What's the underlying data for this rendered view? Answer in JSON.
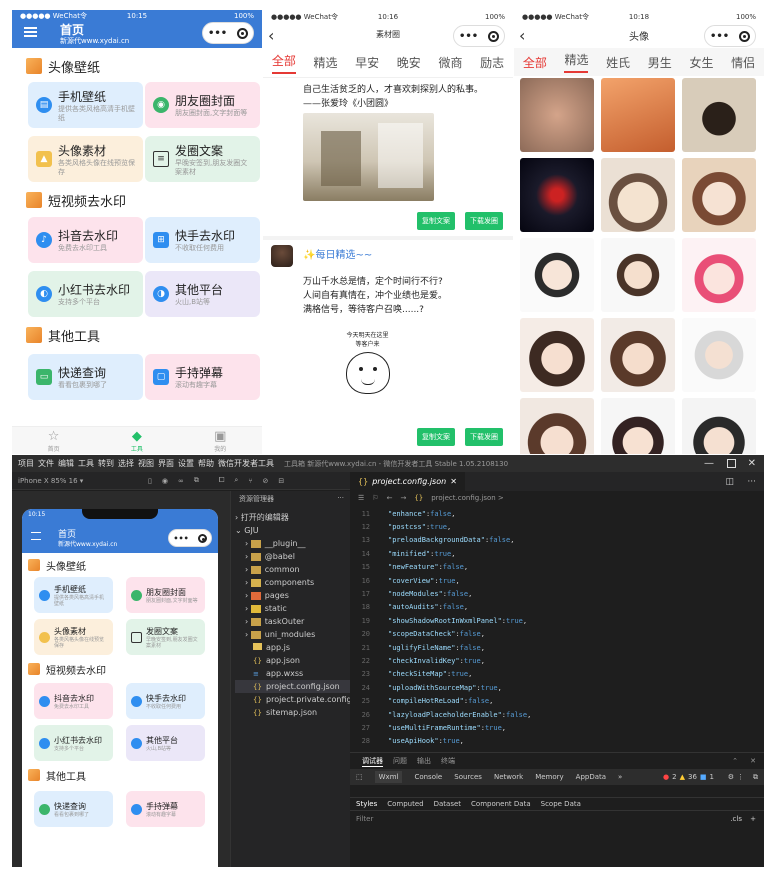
{
  "p1": {
    "status": {
      "carrier": "●●●●● WeChat令",
      "time": "10:15",
      "battery": "100%"
    },
    "title": "首页",
    "subtitle": "新源代www.xydai.cn",
    "sections": [
      {
        "title": "头像壁纸"
      },
      {
        "title": "短视频去水印"
      },
      {
        "title": "其他工具"
      }
    ],
    "cards": [
      {
        "title": "手机壁纸",
        "desc": "提供各类风格高清手机壁纸"
      },
      {
        "title": "朋友圈封面",
        "desc": "朋友圈封面,文字封面等"
      },
      {
        "title": "头像素材",
        "desc": "各类风格头像在线预览保存"
      },
      {
        "title": "发圈文案",
        "desc": "早晚安签到,朋友发圈文案素材"
      },
      {
        "title": "抖音去水印",
        "desc": "免费去水印工具"
      },
      {
        "title": "快手去水印",
        "desc": "不收取任何费用"
      },
      {
        "title": "小红书去水印",
        "desc": "支持多个平台"
      },
      {
        "title": "其他平台",
        "desc": "火山,B站等"
      },
      {
        "title": "快递查询",
        "desc": "看看包裹到哪了"
      },
      {
        "title": "手持弹幕",
        "desc": "滚动有趣字幕"
      }
    ],
    "nav": [
      "首页",
      "工具",
      "我的"
    ]
  },
  "p2": {
    "status": {
      "carrier": "●●●●● WeChat令",
      "time": "10:16",
      "battery": "100%"
    },
    "title": "素材圈",
    "tabs": [
      "全部",
      "精选",
      "早安",
      "晚安",
      "微商",
      "励志"
    ],
    "text1a": "自己生活贫乏的人，才喜欢刺探别人的私事。",
    "text1b": "——张爱玲《小团圆》",
    "btn_copy": "复制文案",
    "btn_dl": "下载发圈",
    "post_name": "✨每日精选~~",
    "text2a": "万山千水总是情，定个时间行不行?",
    "text2b": "人间自有真情在，冲个业绩也是爱。",
    "text2c": "满格信号，等待客户召唤......?",
    "sticker_a": "今天明天在这里",
    "sticker_b": "等客户来"
  },
  "p3": {
    "status": {
      "carrier": "●●●●● WeChat令",
      "time": "10:18",
      "battery": "100%"
    },
    "title": "头像",
    "tabs": [
      "全部",
      "精选",
      "姓氏",
      "男生",
      "女生",
      "情侣"
    ]
  },
  "ide": {
    "menu": [
      "项目",
      "文件",
      "编辑",
      "工具",
      "转到",
      "选择",
      "视图",
      "界面",
      "设置",
      "帮助",
      "微信开发者工具"
    ],
    "title": "工具箱 新源代www.xydai.cn - 微信开发者工具 Stable 1.05.2108130",
    "device": "iPhone X 85% 16 ▾",
    "explorer": "资源管理器",
    "open_editors": "打开的编辑器",
    "root": "GJU",
    "tree": [
      {
        "name": "__plugin__",
        "t": "dir"
      },
      {
        "name": "@babel",
        "t": "dir"
      },
      {
        "name": "common",
        "t": "dir"
      },
      {
        "name": "components",
        "t": "dir"
      },
      {
        "name": "pages",
        "t": "dir"
      },
      {
        "name": "static",
        "t": "dir"
      },
      {
        "name": "taskOuter",
        "t": "dir"
      },
      {
        "name": "uni_modules",
        "t": "dir"
      },
      {
        "name": "app.js",
        "t": "js"
      },
      {
        "name": "app.json",
        "t": "json"
      },
      {
        "name": "app.wxss",
        "t": "wxss"
      },
      {
        "name": "project.config.json",
        "t": "json"
      },
      {
        "name": "project.private.config.js...",
        "t": "json"
      },
      {
        "name": "sitemap.json",
        "t": "json"
      }
    ],
    "tab": "project.config.json",
    "breadcrumb": "project.config.json >",
    "code": [
      {
        "n": "11",
        "k": "\"enhance\"",
        "v": "false"
      },
      {
        "n": "12",
        "k": "\"postcss\"",
        "v": "true"
      },
      {
        "n": "13",
        "k": "\"preloadBackgroundData\"",
        "v": "false"
      },
      {
        "n": "14",
        "k": "\"minified\"",
        "v": "true"
      },
      {
        "n": "15",
        "k": "\"newFeature\"",
        "v": "false"
      },
      {
        "n": "16",
        "k": "\"coverView\"",
        "v": "true"
      },
      {
        "n": "17",
        "k": "\"nodeModules\"",
        "v": "false"
      },
      {
        "n": "18",
        "k": "\"autoAudits\"",
        "v": "false"
      },
      {
        "n": "19",
        "k": "\"showShadowRootInWxmlPanel\"",
        "v": "true"
      },
      {
        "n": "20",
        "k": "\"scopeDataCheck\"",
        "v": "false"
      },
      {
        "n": "21",
        "k": "\"uglifyFileName\"",
        "v": "false"
      },
      {
        "n": "22",
        "k": "\"checkInvalidKey\"",
        "v": "true"
      },
      {
        "n": "23",
        "k": "\"checkSiteMap\"",
        "v": "true"
      },
      {
        "n": "24",
        "k": "\"uploadWithSourceMap\"",
        "v": "true"
      },
      {
        "n": "25",
        "k": "\"compileHotReLoad\"",
        "v": "false"
      },
      {
        "n": "26",
        "k": "\"lazyloadPlaceholderEnable\"",
        "v": "false"
      },
      {
        "n": "27",
        "k": "\"useMultiFrameRuntime\"",
        "v": "true"
      },
      {
        "n": "28",
        "k": "\"useApiHook\"",
        "v": "true"
      }
    ],
    "panel_tabs": [
      "调试器",
      "问题",
      "输出",
      "终端"
    ],
    "dev_tabs": [
      "Wxml",
      "Console",
      "Sources",
      "Network",
      "Memory",
      "AppData",
      "»"
    ],
    "badges": {
      "err": "2",
      "warn": "36",
      "info": "1"
    },
    "sub_tabs": [
      "Styles",
      "Computed",
      "Dataset",
      "Component Data",
      "Scope Data"
    ],
    "filter": "Filter",
    "cls": ".cls",
    "plus": "+",
    "sim_time": "10:15"
  },
  "colors": {
    "blue": "#3a7bd5",
    "red": "#e53935",
    "green": "#22c06a"
  }
}
